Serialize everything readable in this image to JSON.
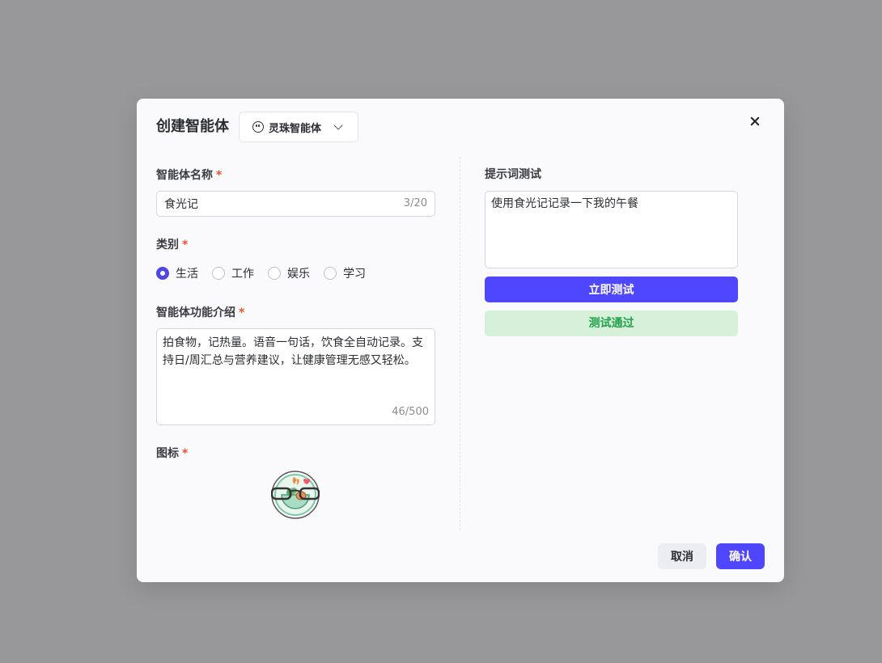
{
  "modal": {
    "title": "创建智能体",
    "agent_selector": {
      "icon": "robot-face-icon",
      "label": "灵珠智能体"
    },
    "close_icon": "close-icon"
  },
  "form": {
    "name": {
      "label": "智能体名称",
      "required_mark": "*",
      "value": "食光记",
      "counter": "3/20"
    },
    "category": {
      "label": "类别",
      "required_mark": "*",
      "options": [
        {
          "label": "生活",
          "selected": true
        },
        {
          "label": "工作",
          "selected": false
        },
        {
          "label": "娱乐",
          "selected": false
        },
        {
          "label": "学习",
          "selected": false
        }
      ]
    },
    "description": {
      "label": "智能体功能介绍",
      "required_mark": "*",
      "value": "拍食物，记热量。语音一句话，饮食全自动记录。支持日/周汇总与营养建议，让健康管理无感又轻松。",
      "counter": "46/500"
    },
    "icon": {
      "label": "图标",
      "required_mark": "*",
      "image": "food-bowl-logo-icon"
    }
  },
  "prompt_test": {
    "label": "提示词测试",
    "value": "使用食光记记录一下我的午餐",
    "test_button": "立即测试",
    "result": "测试通过"
  },
  "footer": {
    "cancel": "取消",
    "confirm": "确认"
  },
  "colors": {
    "primary": "#4f46ff",
    "success_bg": "#d6f0da",
    "success_text": "#21a34a",
    "required": "#f0522b"
  }
}
